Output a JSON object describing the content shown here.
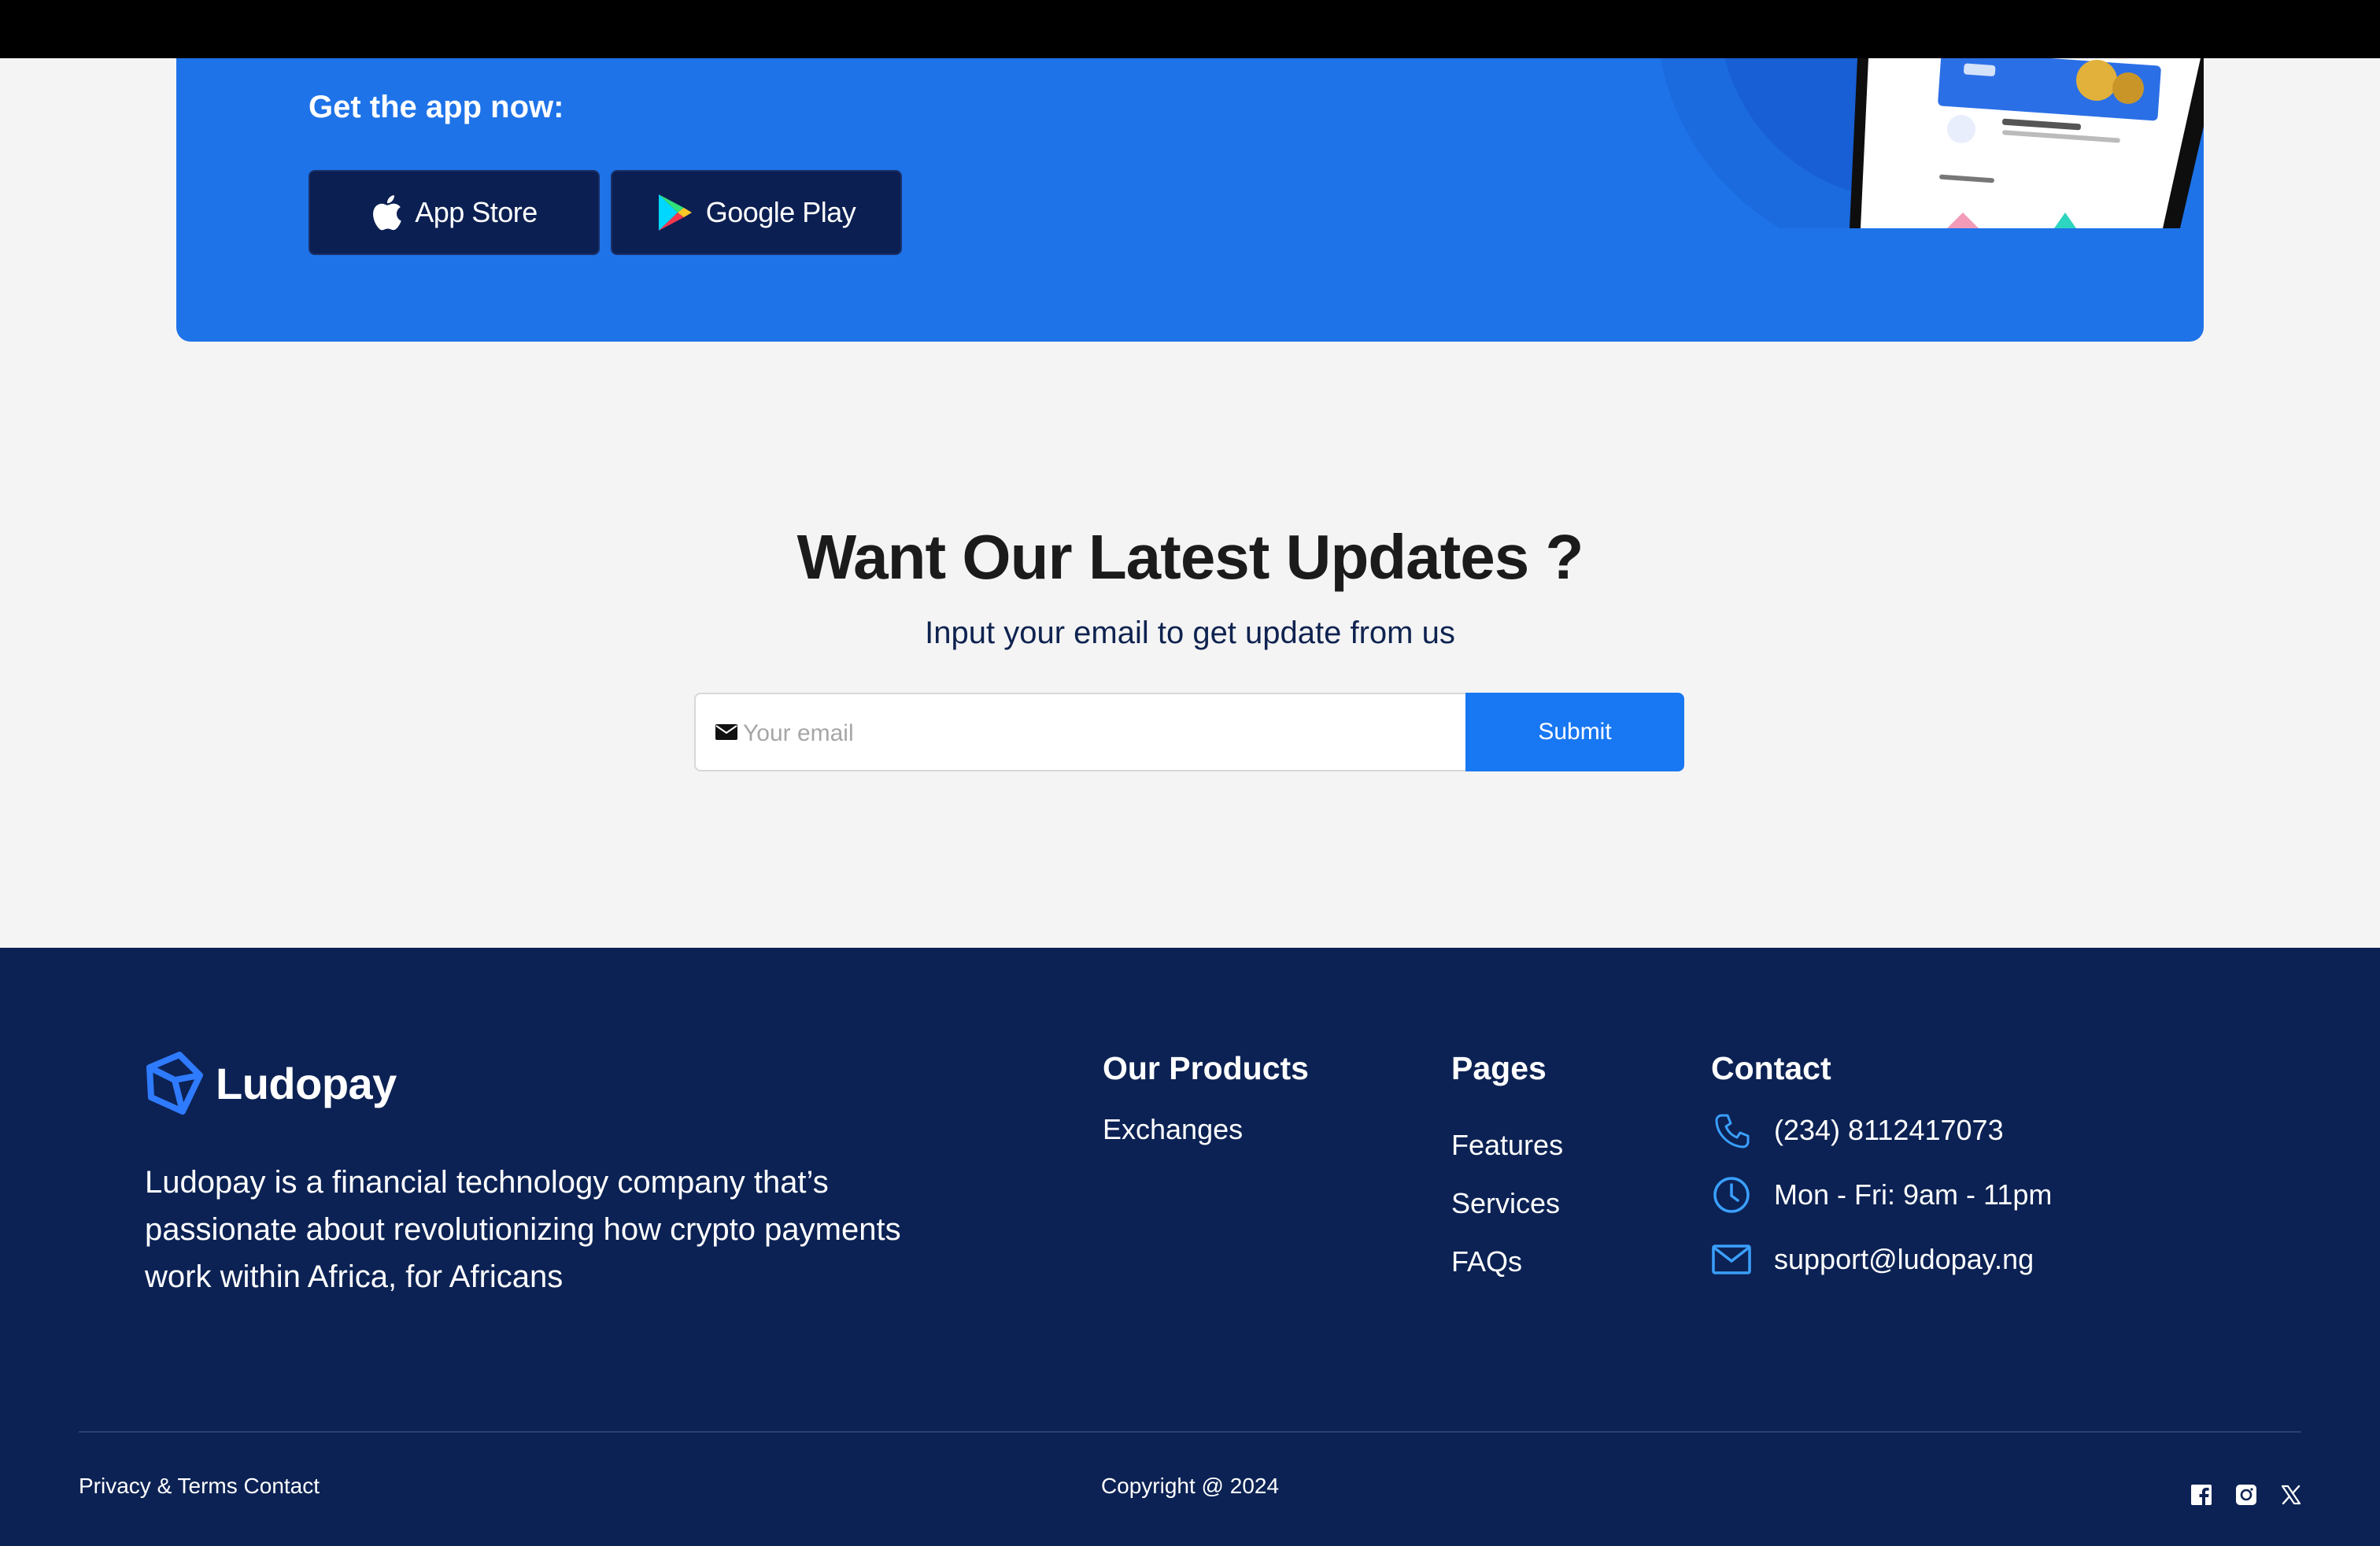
{
  "banner": {
    "title": "Get the app now:",
    "app_store_label": "App Store",
    "google_play_label": "Google Play",
    "background_color": "#1e73e8",
    "button_color": "#0b1f52"
  },
  "newsletter": {
    "title": "Want Our Latest Updates ?",
    "subtitle": "Input your email to get update from us",
    "email_placeholder": "Your email",
    "submit_label": "Submit",
    "accent_color": "#1877f2"
  },
  "footer": {
    "background_color": "#0c2254",
    "brand": "Ludopay",
    "about": "Ludopay is a financial technology company that’s passionate about revolutionizing how crypto payments work within Africa, for Africans",
    "products": {
      "heading": "Our Products",
      "items": [
        "Exchanges"
      ]
    },
    "pages": {
      "heading": "Pages",
      "items": [
        "Features",
        "Services",
        "FAQs"
      ]
    },
    "contact": {
      "heading": "Contact",
      "phone": "(234) 8112417073",
      "hours": "Mon - Fri: 9am - 11pm",
      "email": "support@ludopay.ng"
    },
    "legal": "Privacy & Terms Contact",
    "copyright": "Copyright @ 2024",
    "social_icons": [
      "facebook-icon",
      "instagram-icon",
      "x-icon"
    ]
  }
}
